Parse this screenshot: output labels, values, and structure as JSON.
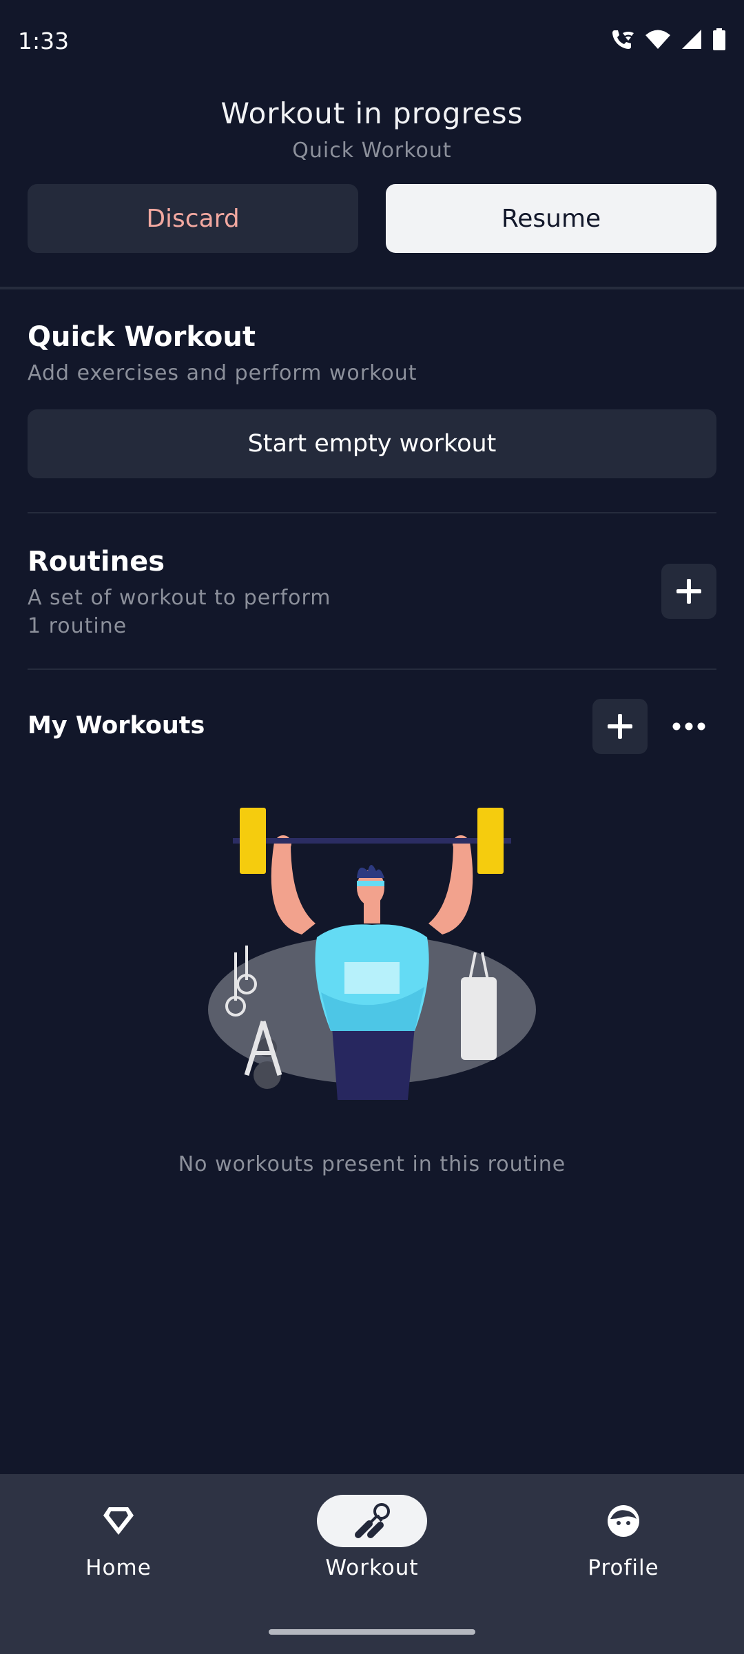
{
  "status_bar": {
    "time": "1:33",
    "icons": [
      "wifi-calling-icon",
      "wifi-icon",
      "signal-icon",
      "battery-icon"
    ]
  },
  "progress": {
    "title": "Workout in progress",
    "subtitle": "Quick Workout",
    "discard_label": "Discard",
    "resume_label": "Resume"
  },
  "quick_workout": {
    "title": "Quick Workout",
    "description": "Add exercises and perform workout",
    "start_label": "Start empty workout"
  },
  "routines": {
    "title": "Routines",
    "description": "A set of workout to perform",
    "count": "1 routine",
    "add_icon": "plus-icon"
  },
  "my_workouts": {
    "title": "My Workouts",
    "add_icon": "plus-icon",
    "more_icon": "more-horizontal-icon",
    "empty_text": "No workouts present in this routine"
  },
  "bottom_nav": {
    "items": [
      {
        "label": "Home",
        "icon": "diamond-icon",
        "active": false
      },
      {
        "label": "Workout",
        "icon": "hand-gripper-icon",
        "active": true
      },
      {
        "label": "Profile",
        "icon": "face-icon",
        "active": false
      }
    ]
  },
  "colors": {
    "background": "#12172a",
    "surface": "#242a3b",
    "nav_background": "#2e3344",
    "discard_text": "#f2a8a0",
    "resume_background": "#f2f3f5"
  }
}
